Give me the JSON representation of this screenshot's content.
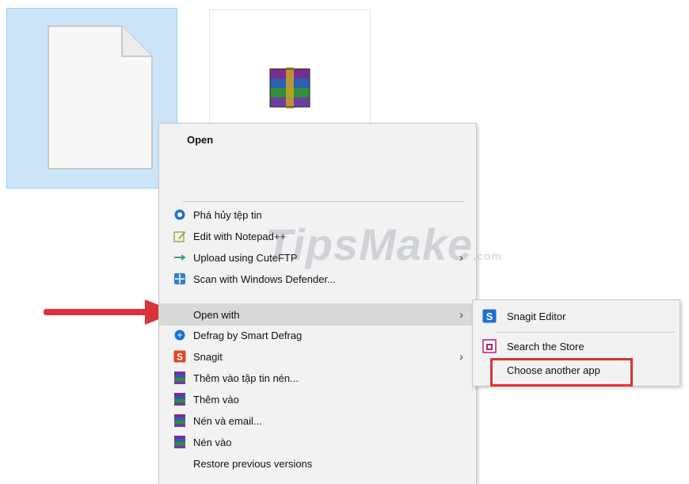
{
  "menu": {
    "open_label": "Open",
    "items": [
      {
        "label": "Phá hủy tệp tin",
        "icon": "shred-icon"
      },
      {
        "label": "Edit with Notepad++",
        "icon": "notepad-icon"
      },
      {
        "label": "Upload using CuteFTP",
        "icon": "cuteftp-icon"
      },
      {
        "label": "Scan with Windows Defender...",
        "icon": "defender-icon"
      },
      {
        "label": "Open with",
        "icon": ""
      },
      {
        "label": "Defrag by Smart Defrag",
        "icon": "defrag-icon"
      },
      {
        "label": "Snagit",
        "icon": "snagit-icon"
      },
      {
        "label": "Thêm vào tập tin nén...",
        "icon": "winrar-icon"
      },
      {
        "label": "Thêm vào",
        "icon": "winrar-icon"
      },
      {
        "label": "Nén và email...",
        "icon": "winrar-icon"
      },
      {
        "label": "Nén vào",
        "icon": "winrar-icon"
      },
      {
        "label": "Restore previous versions",
        "icon": ""
      }
    ],
    "arrow_glyph": "›"
  },
  "submenu": {
    "items": [
      {
        "label": "Snagit Editor",
        "icon": "snagit-editor-icon"
      },
      {
        "label": "Search the Store",
        "icon": "store-icon"
      },
      {
        "label": "Choose another app",
        "icon": ""
      }
    ]
  },
  "watermark": {
    "text": "TipsMake",
    "suffix": ".com"
  },
  "colors": {
    "selection": "#cce4f7",
    "menu_bg": "#f2f2f2",
    "hover": "#d9d9d9",
    "annotation_red": "#d9343a"
  }
}
